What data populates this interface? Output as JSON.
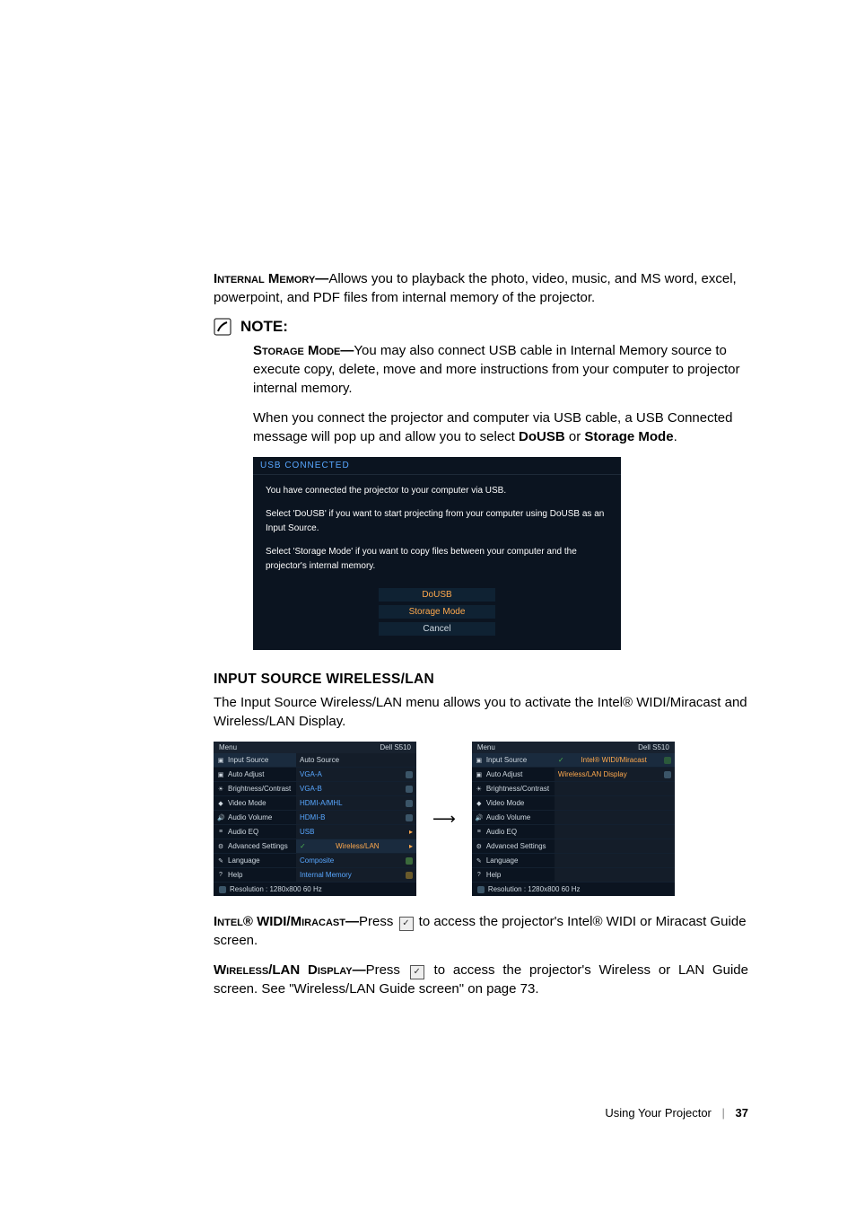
{
  "p1": {
    "lead_bold": "Internal Memory—",
    "rest": "Allows you to playback the photo, video, music, and MS word, excel, powerpoint, and PDF files from internal memory of the projector."
  },
  "note_label": "NOTE:",
  "storage": {
    "lead_bold": "Storage Mode—",
    "rest": "You may also connect USB cable in Internal Memory source to execute copy, delete, move and more instructions from your computer to projector internal memory."
  },
  "connect_para_a": "When you connect the projector and computer via USB cable, a USB Connected message will pop up and allow you to select ",
  "connect_bold_1": "DoUSB",
  "connect_or": " or ",
  "connect_bold_2": "Storage Mode",
  "connect_dot": ".",
  "usb": {
    "header": "USB CONNECTED",
    "l1": "You have connected the projector to your computer via USB.",
    "l2": "Select 'DoUSB' if you want to start projecting from your computer using DoUSB as an Input Source.",
    "l3": "Select 'Storage Mode' if you want to copy files between your computer and the projector's internal memory.",
    "b1": "DoUSB",
    "b2": "Storage Mode",
    "b3": "Cancel"
  },
  "sec_head": "INPUT SOURCE WIRELESS/LAN",
  "sec_desc": "The Input Source Wireless/LAN menu allows you to activate the Intel® WIDI/Miracast and Wireless/LAN Display.",
  "osd": {
    "menu": "Menu",
    "model": "Dell S510",
    "left_items": [
      "Input Source",
      "Auto Adjust",
      "Brightness/Contrast",
      "Video Mode",
      "Audio Volume",
      "Audio EQ",
      "Advanced Settings",
      "Language",
      "Help"
    ],
    "right1": {
      "auto": "Auto Source",
      "opts": [
        "VGA-A",
        "VGA-B",
        "HDMI-A/MHL",
        "HDMI-B",
        "USB",
        "Wireless/LAN",
        "Composite",
        "Internal Memory"
      ]
    },
    "right2": {
      "opts": [
        "Intel® WIDI/Miracast",
        "Wireless/LAN Display"
      ]
    },
    "res": "Resolution :   1280x800 60 Hz"
  },
  "widi": {
    "lead_bold": "Intel® WIDI/Miracast—",
    "a": "Press ",
    "b": " to access the projector's Intel® WIDI or Miracast Guide screen."
  },
  "wlan": {
    "lead_bold": "Wireless/LAN Display—",
    "a": "Press ",
    "b": " to access the projector's Wireless or LAN Guide screen. See \"Wireless/LAN Guide screen\" on page 73."
  },
  "footer_text": "Using Your Projector",
  "page_num": "37"
}
